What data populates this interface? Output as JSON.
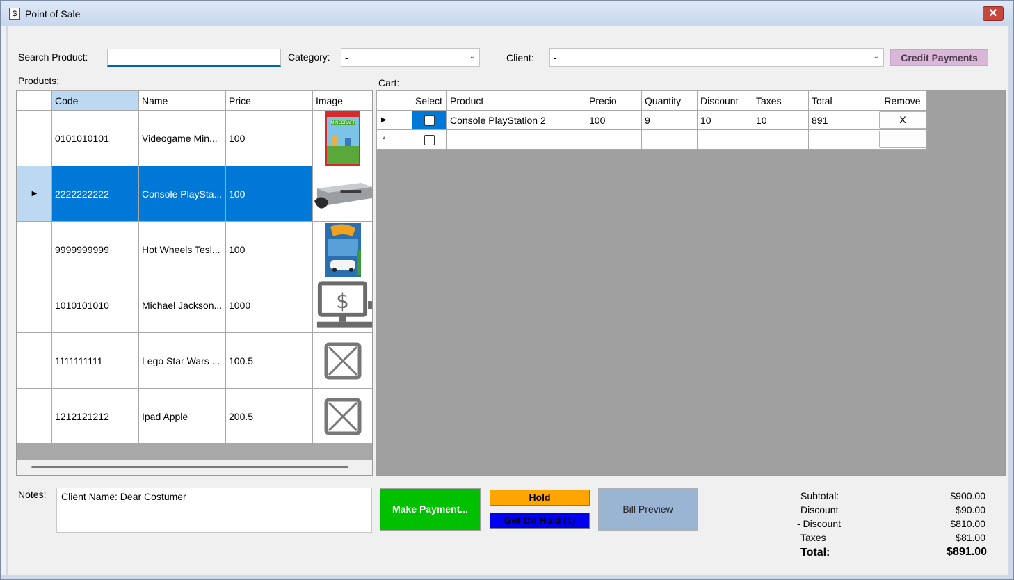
{
  "window": {
    "title": "Point of Sale",
    "close_glyph": "✕",
    "icon": "dollar-document-icon"
  },
  "search": {
    "label": "Search Product:",
    "value": ""
  },
  "category": {
    "label": "Category:",
    "value": "-"
  },
  "client": {
    "label": "Client:",
    "value": "-"
  },
  "credit_button": "Credit Payments",
  "products": {
    "label": "Products:",
    "columns": [
      "Code",
      "Name",
      "Price",
      "Image"
    ],
    "rows": [
      {
        "code": "0101010101",
        "name": "Videogame Min...",
        "price": "100",
        "image": "minecraft-box"
      },
      {
        "code": "2222222222",
        "name": "Console PlaySta...",
        "price": "100",
        "image": "ps2-console",
        "selected": true
      },
      {
        "code": "9999999999",
        "name": "Hot Wheels Tesl...",
        "price": "100",
        "image": "hotwheels-box"
      },
      {
        "code": "1010101010",
        "name": "Michael Jackson...",
        "price": "1000",
        "image": "pos-terminal"
      },
      {
        "code": "1111111111",
        "name": "Lego Star Wars ...",
        "price": "100.5",
        "image": "no-image"
      },
      {
        "code": "1212121212",
        "name": "Ipad Apple",
        "price": "200.5",
        "image": "no-image"
      }
    ]
  },
  "cart": {
    "label": "Cart:",
    "columns": [
      "Select",
      "Product",
      "Precio",
      "Quantity",
      "Discount",
      "Taxes",
      "Total",
      "Remove"
    ],
    "rows": [
      {
        "product": "Console PlayStation 2",
        "precio": "100",
        "quantity": "9",
        "discount": "10",
        "taxes": "10",
        "total": "891",
        "remove": "X"
      }
    ],
    "new_row_marker": "*"
  },
  "notes": {
    "label": "Notes:",
    "value": "Client Name: Dear Costumer"
  },
  "buttons": {
    "make_payment": "Make Payment...",
    "hold": "Hold",
    "get_on_hold": "Get On Hold (1)",
    "bill_preview": "Bill Preview"
  },
  "totals": {
    "subtotal_label": "Subtotal:",
    "subtotal": "$900.00",
    "discount_label": "Discount",
    "discount": "$90.00",
    "minus_discount_label": "- Discount",
    "minus_discount": "$810.00",
    "taxes_label": "Taxes",
    "taxes": "$81.00",
    "total_label": "Total:",
    "total": "$891.00"
  },
  "colors": {
    "selection": "#0078d7",
    "payment": "#00c000",
    "hold": "#ffa500",
    "get_on_hold": "#0000f0",
    "bill_preview": "#9ab4d4",
    "credit": "#d8b7d8"
  }
}
